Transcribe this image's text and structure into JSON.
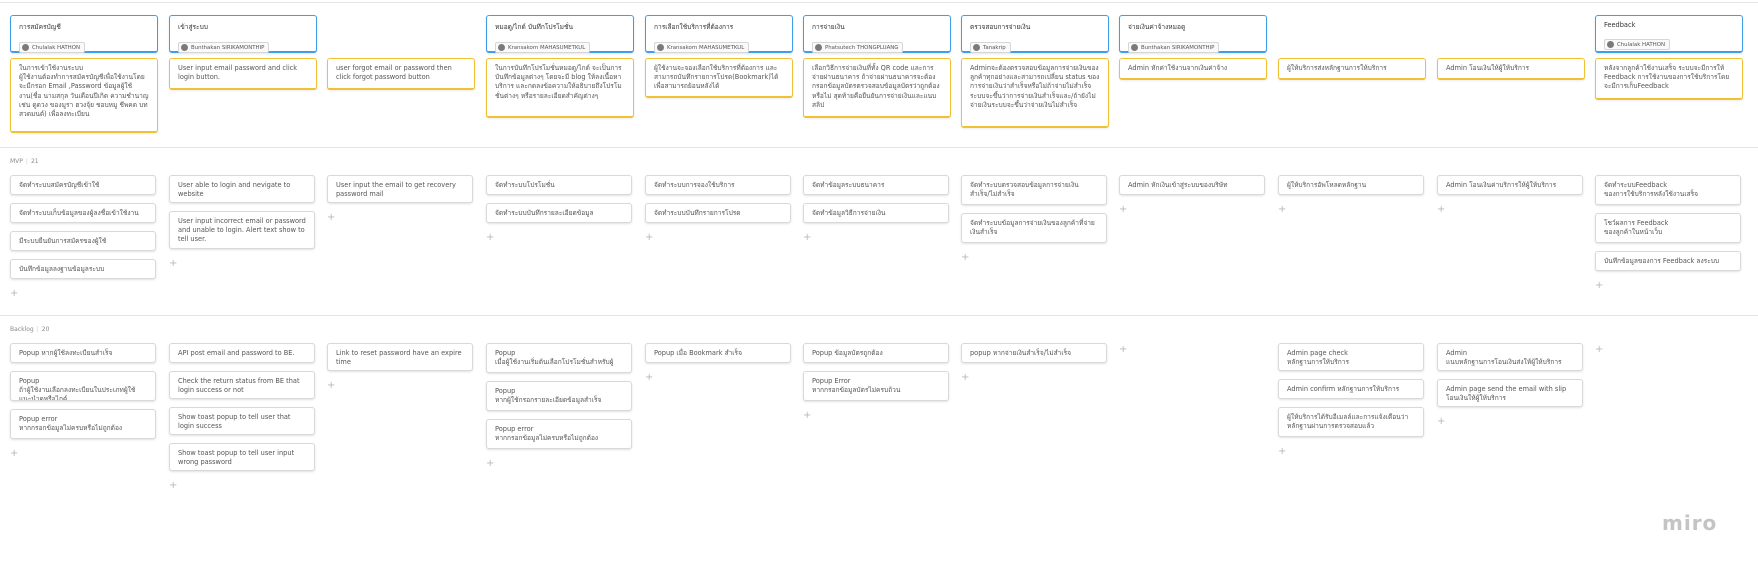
{
  "sections": {
    "mvp": {
      "label": "MVP",
      "count": "21"
    },
    "backlog": {
      "label": "Backlog",
      "count": "20"
    }
  },
  "brand": "miro",
  "columns": [
    {
      "title": "การสมัครบัญชี",
      "assignee": "Chulalak HATHON",
      "story": "ในการเข้าใช้งานระบบ\nผู้ใช้งานต้องทำการสมัครบัญชีเพื่อใช้งานโดยจะมีกรอก Email ,Password ข้อมูลผู้ใช้งาน(ชื่อ นามสกุล วันเดือนปีเกิด ความชำนาญเช่น ดูดวง ของมูรา ฮวงจุ้ย ชอบหมู ชีพคด บทสวดมนต์) เพื่อลงทะเบียน",
      "mvp": [
        "จัดทำระบบสมัครบัญชีเข้าใช้",
        "จัดทำระบบเก็บข้อมูลของผู้ลงชื่อเข้าใช้งาน",
        "มีระบบยืนยันการสมัครของผู้ใช้",
        "บันทึกข้อมูลลงฐานข้อมูลระบบ"
      ],
      "backlog": [
        "Popup หากผู้ใช้ลงทะเบียนสำเร็จ",
        "Popup\nถ้าผู้ใช้งานเลือกลงทะเบียนในประเภทผู้ใช้แนะนำดูหรือไกด์",
        "Popup error\nหากกรอกข้อมูลไม่ครบหรือไม่ถูกต้อง"
      ]
    },
    {
      "title": "เข้าสู่ระบบ",
      "assignee": "Bunthakan SIRIKAMONTHIP",
      "story": "User input email password and click login button.",
      "mvp": [
        "User able to login and nevigate to website",
        "User input incorrect email or password and unable to login. Alert text show to tell user."
      ],
      "backlog": [
        "API post email and password to BE.",
        "Check the return status from BE that login success or not",
        "Show toast popup to tell user that login success",
        "Show toast popup to tell user input wrong password"
      ]
    },
    {
      "title": "",
      "assignee": "",
      "story": "user forgot email or password then click forgot password button",
      "mvp": [
        "User input the email to get recovery password mail"
      ],
      "backlog": [
        "Link to reset password have an expire time"
      ]
    },
    {
      "title": "หมอดู/ไกด์ บันทึกโปรโมชั่น",
      "assignee": "Kransakorn MAHASUMETKUL",
      "story": "ในการบันทึกโปรโมชั่นหมอดู/ไกด์ จะเป็นการบันทึกข้อมูลต่างๆ โดยจะมี blog ให้ลงเนื้อหาบริการ และกดลงข้อความให้อธิบายถึงโปรโมชั่นต่างๆ หรือรายละเอียดสำคัญต่างๆ",
      "mvp": [
        "จัดทำระบบโปรโมชั่น",
        "จัดทำระบบบันทึกรายละเอียดข้อมูล"
      ],
      "backlog": [
        "Popup\nเมื่อผู้ใช้งานเริ่มต้นเลือกโปรโมชั่นสำหรับผู้",
        "Popup\nหากผู้ใช้กรอกรายละเอียดข้อมูลสำเร็จ",
        "Popup error\nหากกรอกข้อมูลไม่ครบหรือไม่ถูกต้อง"
      ]
    },
    {
      "title": "การเลือกใช้บริการที่ต้องการ",
      "assignee": "Kransakorn MAHASUMETKUL",
      "story": "ผู้ใช้งานจะจองเลือกใช้บริการที่ต้องการ และสามารถบันทึกรายการโปรด(Bookmark)ได้เพื่อสามารถย้อนหลังได้",
      "mvp": [
        "จัดทำระบบการจองใช้บริการ",
        "จัดทำระบบบันทึกรายการโปรด"
      ],
      "backlog": [
        "Popup เมื่อ Bookmark สำเร็จ"
      ]
    },
    {
      "title": "การจ่ายเงิน",
      "assignee": "Phatsutech THONGPLUANG",
      "story": "เลือกวิธีการจ่ายเงินที่ทั้ง QR code และการจ่ายผ่านธนาคาร ถ้าจ่ายผ่านธนาคารจะต้องกรอกข้อมูลบัตรตรวจสอบข้อมูลบัตรว่าถูกต้องหรือไม่ สุดท้ายคือยืนยันการจ่ายเงินและแนบสลิป",
      "mvp": [
        "จัดทำข้อมูลระบบธนาคาร",
        "จัดทำข้อมูลวิธีการจ่ายเงิน"
      ],
      "backlog": [
        "Popup ข้อมูลบัตรถูกต้อง",
        "Popup Error\nหากกรอกข้อมูลบัตรไม่ครบถ้วน"
      ]
    },
    {
      "title": "ตรวจสอบการจ่ายเงิน",
      "assignee": "Tanakrip",
      "story": "Adminจะต้องตรวจสอบข้อมูลการจ่ายเงินของลูกค้าทุกอย่างและสามารถเปลี่ยน status ของการจ่ายเงินว่าสำเร็จหรือไม่ถ้าจ่ายไม่สำเร็จระบบจะขึ้นว่าการจ่ายเงินสำเร็จและ/ถ้ายังไม่จ่ายเงินระบบจะขึ้นว่าจ่ายเงินไม่สำเร็จ",
      "mvp": [
        "จัดทำระบบตรวจสอบข้อมูลการจ่ายเงินสำเร็จ/ไม่สำเร็จ",
        "จัดทำระบบข้อมูลการจ่ายเงินของลูกค้าที่จ่ายเงินสำเร็จ"
      ],
      "backlog": [
        "popup หากจ่ายเงินสำเร็จ/ไม่สำเร็จ"
      ]
    },
    {
      "title": "จ่ายเงินค่าจ้างหมอดู",
      "assignee": "Bunthakan SIRIKAMONTHIP",
      "story": "Admin หักค่าใช้งานจากเงินค่าจ้าง",
      "mvp": [
        "Admin หักเงินเข้าสู่ระบบของบริษัท"
      ],
      "backlog": []
    },
    {
      "title": "",
      "assignee": "",
      "story": "ผู้ให้บริการส่งหลักฐานการให้บริการ",
      "mvp": [
        "ผู้ให้บริการอัพโหลดหลักฐาน"
      ],
      "backlog": [
        "Admin page check\nหลักฐานการให้บริการ",
        "Admin confirm หลักฐานการให้บริการ",
        "ผู้ให้บริการได้รับอีเมลล์และการแจ้งเตือนว่าหลักฐานผ่านการตรวจสอบแล้ว"
      ]
    },
    {
      "title": "",
      "assignee": "",
      "story": "Admin โอนเงินให้ผู้ให้บริการ",
      "mvp": [
        "Admin โอนเงินค่าบริการให้ผู้ให้บริการ"
      ],
      "backlog": [
        "Admin\nแนบหลักฐานการโอนเงินส่งให้ผู้ให้บริการ",
        "Admin page send the email with slip\nโอนเงินให้ผู้ให้บริการ"
      ]
    },
    {
      "title": "Feedback",
      "assignee": "Chulalak HATHON",
      "story": "หลังจากลูกค้าใช้งานเสร็จ ระบบจะมีการให้ Feedback การใช้งานของการใช้บริการโดยจะมีการเก็บFeedback",
      "mvp": [
        "จัดทำระบบFeedback\nของการใช้บริการหลังใช้งานเสร็จ",
        "โชว์ผลการ Feedback\nของลูกค้าในหน้าเว็บ",
        "บันทึกข้อมูลของการ Feedback ลงระบบ"
      ],
      "backlog": []
    }
  ]
}
